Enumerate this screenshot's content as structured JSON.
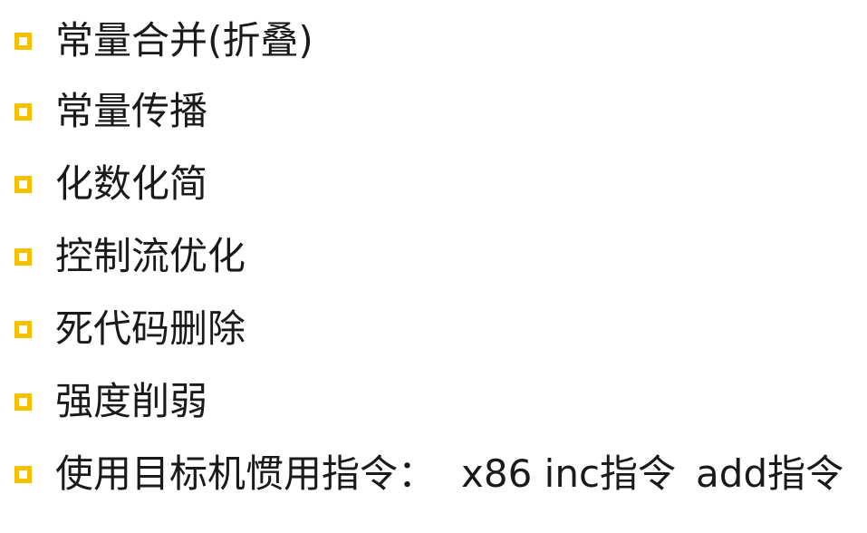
{
  "slide": {
    "bullet_color": "#F5C000",
    "items": [
      {
        "text": "常量合并(折叠)"
      },
      {
        "text": "常量传播"
      },
      {
        "text": "化数化简"
      },
      {
        "text": "控制流优化"
      },
      {
        "text": "死代码删除"
      },
      {
        "text": "强度削弱"
      },
      {
        "text": "使用目标机惯用指令：",
        "example_1": "x86 inc指令",
        "example_2": "add指令"
      }
    ]
  }
}
